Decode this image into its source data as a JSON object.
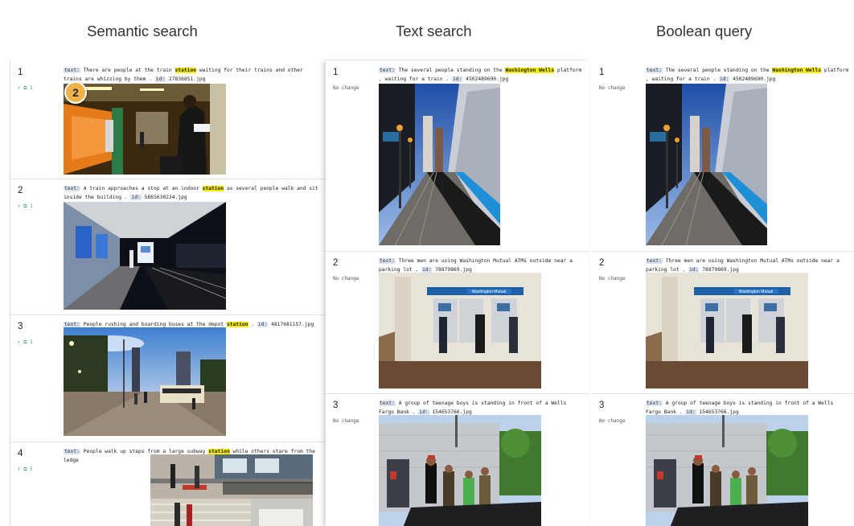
{
  "headings": {
    "semantic": "Semantic search",
    "text": "Text search",
    "boolean": "Boolean query"
  },
  "labels": {
    "text_tag": "text:",
    "id_tag": "id:"
  },
  "badge": "2",
  "semantic": [
    {
      "rank": "1",
      "delta": "↑ ⧉ 1",
      "pre": "There are people at the train ",
      "hl": "station",
      "post": " waiting for their trains and other trains are whizzing by them .",
      "id": "27836851.jpg"
    },
    {
      "rank": "2",
      "delta": "↑ ⧉ 1",
      "pre": "A train approaches a stop at an indoor ",
      "hl": "station",
      "post": " as several people walk and sit inside the building .",
      "id": "5865630234.jpg"
    },
    {
      "rank": "3",
      "delta": "↑ ⧉ 1",
      "pre": "People rushing and boarding buses at the depot ",
      "hl": "station",
      "post": " .",
      "id": "4817681157.jpg"
    },
    {
      "rank": "4",
      "delta": "↑ ⧉ 5",
      "pre": "People walk up steps from a large subway ",
      "hl": "station",
      "post": " while others stare from the ledge",
      "id": ""
    }
  ],
  "text_results": [
    {
      "rank": "1",
      "delta": "No change",
      "pre": "The several people standing on the ",
      "hl": "Washington Wells",
      "post": " platform , waiting for a train .",
      "id": "4502489690.jpg"
    },
    {
      "rank": "2",
      "delta": "No change",
      "pre": "Three men are using Washington Mutual ATMs outside near a parking lot .",
      "hl": "",
      "post": "",
      "id": "78879869.jpg"
    },
    {
      "rank": "3",
      "delta": "No change",
      "pre": "A group of teenage boys is standing in front of a Wells Fargo Bank .",
      "hl": "",
      "post": "",
      "id": "154653766.jpg"
    }
  ],
  "boolean_results": [
    {
      "rank": "1",
      "delta": "No change",
      "pre": "The several people standing on the ",
      "hl": "Washington Wells",
      "post": " platform , waiting for a train .",
      "id": "4502489690.jpg"
    },
    {
      "rank": "2",
      "delta": "No change",
      "pre": "Three men are using Washington Mutual ATMs outside near a parking lot .",
      "hl": "",
      "post": "",
      "id": "78879869.jpg"
    },
    {
      "rank": "3",
      "delta": "No change",
      "pre": "A group of teenage boys is standing in front of a Wells Fargo Bank .",
      "hl": "",
      "post": "",
      "id": "154653766.jpg"
    }
  ],
  "image_text": {
    "atm_sign": "Washington Mutual",
    "platform_sign": "Washington/Wells"
  },
  "colors": {
    "highlight": "#f5ec00",
    "tag_bg": "#dbe4ef",
    "delta_up": "#2e9a7a",
    "badge": "#f0b34a"
  }
}
